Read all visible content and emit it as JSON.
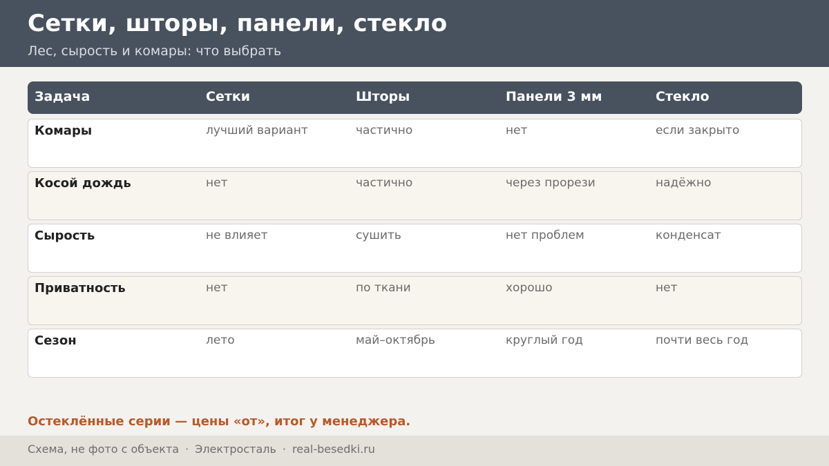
{
  "header": {
    "title": "Сетки, шторы, панели, стекло",
    "subtitle": "Лес, сырость и комары: что выбрать"
  },
  "table": {
    "columns": [
      "Задача",
      "Сетки",
      "Шторы",
      "Панели 3 мм",
      "Стекло"
    ],
    "rows": [
      {
        "task": "Комары",
        "values": [
          "лучший вариант",
          "частично",
          "нет",
          "если закрыто"
        ]
      },
      {
        "task": "Косой дождь",
        "values": [
          "нет",
          "частично",
          "через прорези",
          "надёжно"
        ]
      },
      {
        "task": "Сырость",
        "values": [
          "не влияет",
          "сушить",
          "нет проблем",
          "конденсат"
        ]
      },
      {
        "task": "Приватность",
        "values": [
          "нет",
          "по ткани",
          "хорошо",
          "нет"
        ]
      },
      {
        "task": "Сезон",
        "values": [
          "лето",
          "май–октябрь",
          "круглый год",
          "почти весь год"
        ]
      }
    ]
  },
  "note": "Остеклённые серии — цены «от», итог у менеджера.",
  "footer": {
    "items": [
      "Схема, не фото с объекта",
      "Электросталь",
      "real-besedki.ru"
    ],
    "separator": "·"
  },
  "colors": {
    "header_bg": "#48515e",
    "page_bg": "#f4f2ee",
    "accent": "#b85a2a",
    "row_alt_bg": "#f8f5ee"
  }
}
